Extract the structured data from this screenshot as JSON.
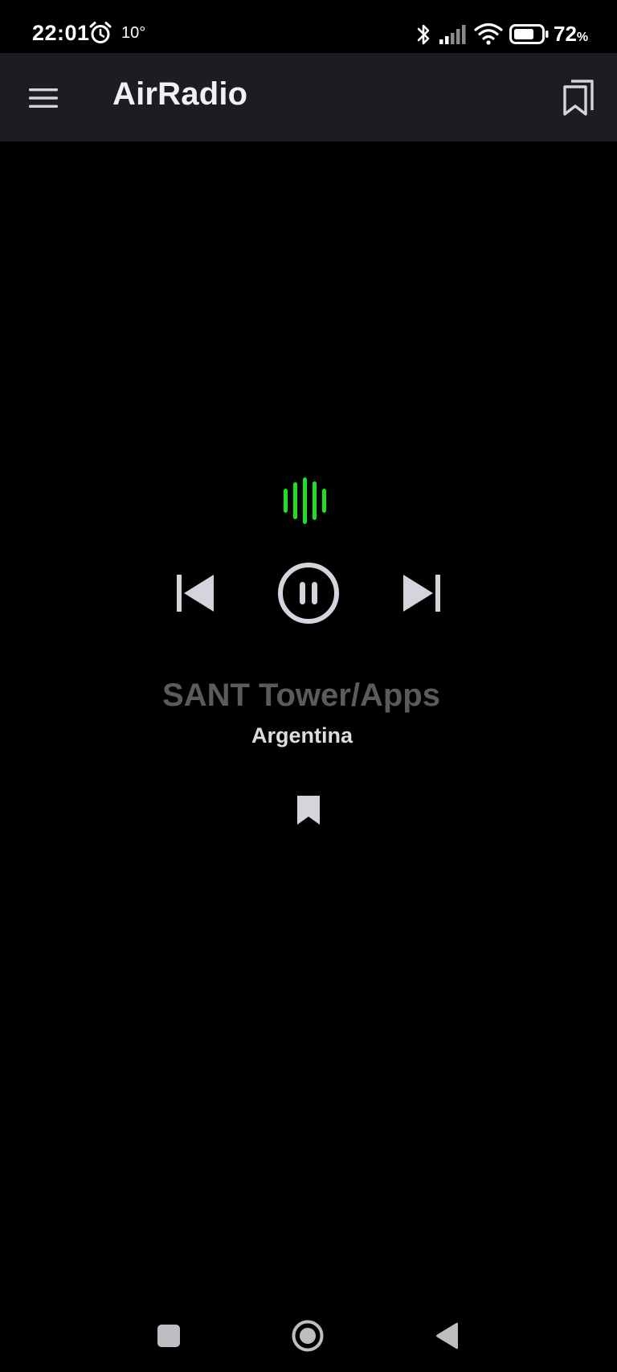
{
  "status_bar": {
    "time": "22:01",
    "temperature": "10°",
    "battery_level": "72",
    "battery_unit": "%",
    "icons": [
      "alarm-icon",
      "bluetooth-icon",
      "signal-icon",
      "wifi-icon",
      "battery-icon"
    ]
  },
  "app_bar": {
    "title": "AirRadio",
    "left_icon": "menu-icon",
    "right_icon": "bookmarks-icon"
  },
  "player": {
    "station_name": "SANT Tower/Apps",
    "country": "Argentina",
    "state": "playing",
    "icons": [
      "equalizer-icon",
      "skip-previous-icon",
      "pause-icon",
      "skip-next-icon",
      "bookmark-icon"
    ]
  },
  "colors": {
    "background": "#000000",
    "app_bar": "#1d1c22",
    "accent_green": "#22dd22",
    "icon": "#d6d3dc",
    "station_name": "#5b5b5f"
  },
  "nav_bar": {
    "icons": [
      "recents-icon",
      "home-icon",
      "back-icon"
    ]
  }
}
